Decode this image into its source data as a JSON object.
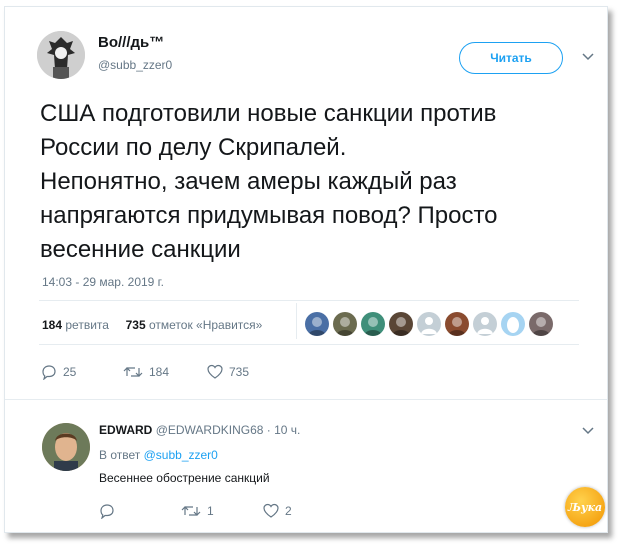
{
  "tweet": {
    "display_name": "Во///дь™",
    "handle": "@subb_zzer0",
    "follow_label": "Читать",
    "text": "США подготовили новые санкции против России по делу Скрипалей.\nНепонятно, зачем амеры каждый раз напрягаются придумывая повод? Просто весенние санкции",
    "timestamp": "14:03 - 29 мар. 2019 г.",
    "retweet_count": "184",
    "retweet_label": "ретвита",
    "like_count": "735",
    "like_label": "отметок «Нравится»",
    "actions": {
      "replies": "25",
      "retweets": "184",
      "likes": "735"
    }
  },
  "likers": [
    {
      "icon": "liker-avatar-1",
      "color": "#4a6fa5"
    },
    {
      "icon": "liker-avatar-2",
      "color": "#6b6b4f"
    },
    {
      "icon": "liker-avatar-3",
      "color": "#3f8f7a"
    },
    {
      "icon": "liker-avatar-4",
      "color": "#5a4636"
    },
    {
      "icon": "default-avatar",
      "color": "#c4cfd6"
    },
    {
      "icon": "liker-avatar-6",
      "color": "#8a4b2f"
    },
    {
      "icon": "default-avatar",
      "color": "#c4cfd6"
    },
    {
      "icon": "egg-avatar",
      "color": "#a6d4f2"
    },
    {
      "icon": "liker-avatar-9",
      "color": "#7a6a6a"
    }
  ],
  "reply": {
    "display_name": "EDWARD",
    "handle": "@EDWARDKING68",
    "time": "· 10 ч.",
    "in_reply_prefix": "В ответ",
    "in_reply_handle": "@subb_zzer0",
    "text": "Весеннее обострение санкций",
    "actions": {
      "replies": "",
      "retweets": "1",
      "likes": "2"
    }
  },
  "watermark_text": "Љука",
  "colors": {
    "accent": "#1da1f2",
    "secondary_text": "#657786",
    "divider": "#e6ecf0"
  }
}
